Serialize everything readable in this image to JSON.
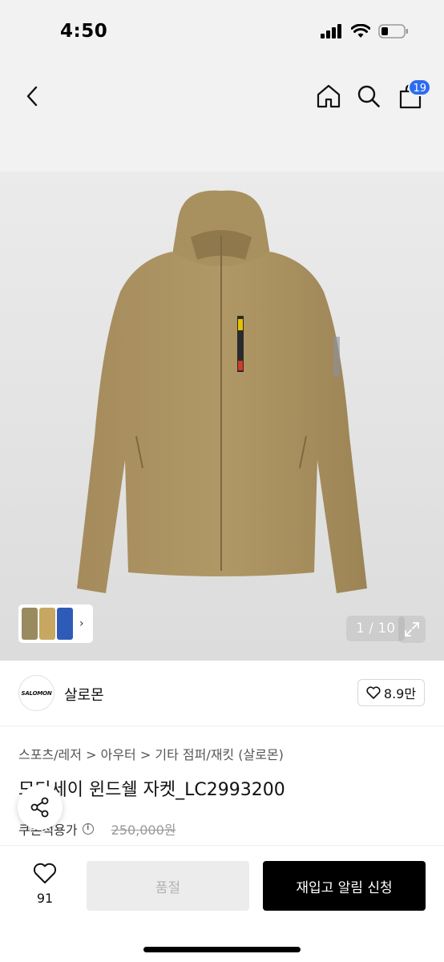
{
  "status": {
    "time": "4:50"
  },
  "nav": {
    "cart_count": "19"
  },
  "gallery": {
    "current": "1",
    "separator": "/",
    "total": "10",
    "thumb_colors": [
      "#9a8a60",
      "#c7a761",
      "#2f5bb8"
    ]
  },
  "brand": {
    "logo_text": "SALOMON",
    "name": "살로몬",
    "likes": "8.9만"
  },
  "breadcrumb": {
    "c1": "스포츠/레저",
    "c2": "아우터",
    "c3": "기타 점퍼/재킷 (살로몬)",
    "sep": ">"
  },
  "product": {
    "title": "모티세이 윈드쉘 자켓_LC2993200",
    "price_label": "쿠폰적용가",
    "original_price": "250,000원"
  },
  "bottom": {
    "wish_count": "91",
    "soldout_label": "품절",
    "restock_label": "재입고 알림 신청"
  },
  "colors": {
    "badge": "#2d6cf0",
    "jacket": "#a99060",
    "primary_button": "#000000"
  }
}
